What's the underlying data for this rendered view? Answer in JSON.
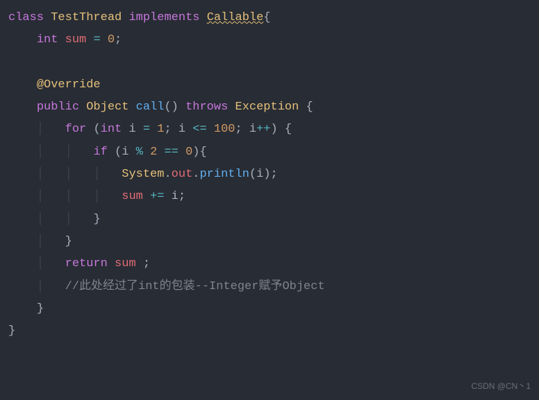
{
  "code": {
    "line1": {
      "kw_class": "class",
      "classname": "TestThread",
      "kw_implements": "implements",
      "callable": "Callable"
    },
    "line2": {
      "type": "int",
      "varname": "sum",
      "eq": "=",
      "zero": "0",
      "semi": ";"
    },
    "line4": {
      "annotation": "@Override"
    },
    "line5": {
      "kw_public": "public",
      "type_object": "Object",
      "method_call": "call",
      "kw_throws": "throws",
      "exception": "Exception"
    },
    "line6": {
      "kw_for": "for",
      "kw_int": "int",
      "one": "1",
      "hundred": "100"
    },
    "line7": {
      "kw_if": "if",
      "two": "2",
      "zero": "0"
    },
    "line8": {
      "system": "System",
      "out": "out",
      "println": "println"
    },
    "line9": {
      "sum": "sum",
      "pluseq": "+="
    },
    "line12": {
      "kw_return": "return",
      "sum": "sum"
    },
    "line13": {
      "comment": "//此处经过了int的包装--Integer赋予Object"
    }
  },
  "watermark": "CSDN @CN丶1"
}
